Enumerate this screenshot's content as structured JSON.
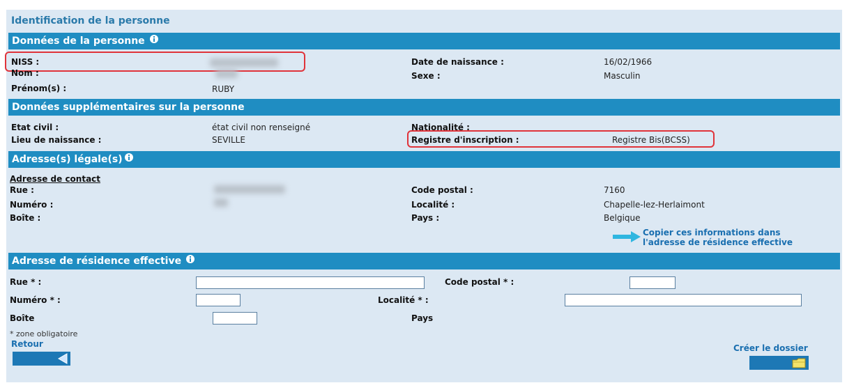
{
  "page_title": "Identification de la personne",
  "sections": {
    "person": "Données de la personne",
    "additional": "Données supplémentaires sur la personne",
    "legal": "Adresse(s) légale(s)",
    "residence": "Adresse de résidence effective"
  },
  "person": {
    "niss_label": "NISS :",
    "nom_label": "Nom :",
    "prenom_label": "Prénom(s) :",
    "prenom_value": "RUBY",
    "dob_label": "Date de naissance :",
    "dob_value": "16/02/1966",
    "sexe_label": "Sexe :",
    "sexe_value": "Masculin"
  },
  "additional": {
    "etat_label": "Etat civil :",
    "etat_value": "état civil non renseigné",
    "lieu_label": "Lieu de naissance :",
    "lieu_value": "SEVILLE",
    "nat_label": "Nationalité :",
    "registre_label": "Registre d'inscription :",
    "registre_value": "Registre Bis(BCSS)"
  },
  "legal": {
    "contact_heading": "Adresse de contact",
    "rue_label": "Rue :",
    "numero_label": "Numéro :",
    "boite_label": "Boîte :",
    "cp_label": "Code postal :",
    "cp_value": "7160",
    "localite_label": "Localité :",
    "localite_value": "Chapelle-lez-Herlaimont",
    "pays_label": "Pays :",
    "pays_value": "Belgique",
    "copy_link_line1": "Copier ces informations dans",
    "copy_link_line2": "l'adresse de résidence effective"
  },
  "residence": {
    "rue_label": "Rue * :",
    "numero_label": "Numéro * :",
    "boite_label": "Boîte",
    "cp_label": "Code postal * :",
    "localite_label": "Localité * :",
    "pays_label": "Pays",
    "rue_value": "",
    "numero_value": "",
    "boite_value": "",
    "cp_value": "",
    "localite_value": ""
  },
  "required_note": "* zone obligatoire",
  "nav": {
    "back_label": "Retour",
    "create_label": "Créer le dossier"
  },
  "colors": {
    "section_bar": "#1f8dc2",
    "page_bg": "#dce8f3",
    "highlight": "#e0333a",
    "link": "#1a6fb0"
  },
  "icons": {
    "info": "info-icon",
    "arrow": "arrow-right-icon",
    "back": "triangle-left-icon",
    "folder": "folder-icon"
  }
}
